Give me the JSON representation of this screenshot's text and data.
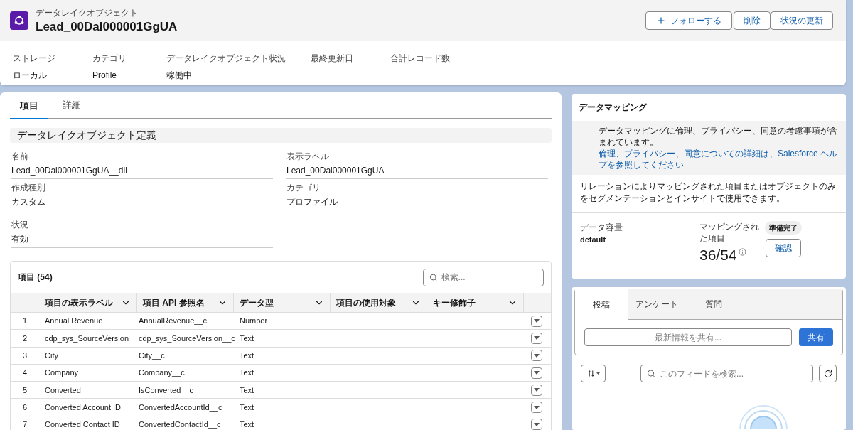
{
  "header": {
    "object_type": "データレイクオブジェクト",
    "title": "Lead_00Dal000001GgUA",
    "buttons": [
      {
        "kind": "follow",
        "label": "フォローする"
      },
      {
        "kind": "plain",
        "label": "削除"
      },
      {
        "kind": "plain",
        "label": "状況の更新"
      }
    ],
    "fields": [
      {
        "label": "ストレージ",
        "value": "ローカル"
      },
      {
        "label": "カテゴリ",
        "value": "Profile"
      },
      {
        "label": "データレイクオブジェクト状況",
        "value": "稼働中"
      },
      {
        "label": "最終更新日"
      },
      {
        "label": "合計レコード数"
      }
    ]
  },
  "tabs": [
    {
      "label": "項目",
      "selected": true
    },
    {
      "label": "詳細",
      "selected": false
    }
  ],
  "definition": {
    "title": "データレイクオブジェクト定義",
    "fields": [
      {
        "label": "名前",
        "value": "Lead_00Dal000001GgUA__dll"
      },
      {
        "label": "表示ラベル",
        "value": "Lead_00Dal000001GgUA"
      },
      {
        "label": "作成種別",
        "value": "カスタム"
      },
      {
        "label": "カテゴリ",
        "value": "プロファイル"
      },
      {
        "label": "状況",
        "value": "有効"
      }
    ]
  },
  "table": {
    "title": "項目 (54)",
    "search_placeholder": "検索...",
    "columns": [
      "項目の表示ラベル",
      "項目 API 参照名",
      "データ型",
      "項目の使用対象",
      "キー修飾子"
    ],
    "rows": [
      {
        "number": "1",
        "cells": [
          "Annual Revenue",
          "AnnualRevenue__c",
          "Number"
        ]
      },
      {
        "number": "2",
        "cells": [
          "cdp_sys_SourceVersion",
          "cdp_sys_SourceVersion__c",
          "Text"
        ]
      },
      {
        "number": "3",
        "cells": [
          "City",
          "City__c",
          "Text"
        ]
      },
      {
        "number": "4",
        "cells": [
          "Company",
          "Company__c",
          "Text"
        ]
      },
      {
        "number": "5",
        "cells": [
          "Converted",
          "IsConverted__c",
          "Text"
        ]
      },
      {
        "number": "6",
        "cells": [
          "Converted Account ID",
          "ConvertedAccountId__c",
          "Text"
        ]
      },
      {
        "number": "7",
        "cells": [
          "Converted Contact ID",
          "ConvertedContactId__c",
          "Text"
        ]
      }
    ]
  },
  "mapping": {
    "title": "データマッピング",
    "notice": "データマッピングに倫理、プライバシー、同意の考慮事項が含まれています。",
    "notice_link": "倫理、プライバシー、同意についての詳細は、Salesforce ヘルプを参照してください",
    "description": "リレーションによりマッピングされた項目またはオブジェクトのみをセグメンテーションとインサイトで使用できます。",
    "capacity_label": "データ容量",
    "capacity_value": "default",
    "mapped_label": "マッピングされた項目",
    "mapped_value": "36/54",
    "badge": "準備完了",
    "confirm": "確認"
  },
  "feed": {
    "tabs": [
      {
        "label": "投稿",
        "selected": true
      },
      {
        "label": "アンケート",
        "selected": false
      },
      {
        "label": "質問",
        "selected": false
      }
    ],
    "share_placeholder": "最新情報を共有...",
    "share_button": "共有",
    "search_placeholder": "このフィードを検索..."
  }
}
